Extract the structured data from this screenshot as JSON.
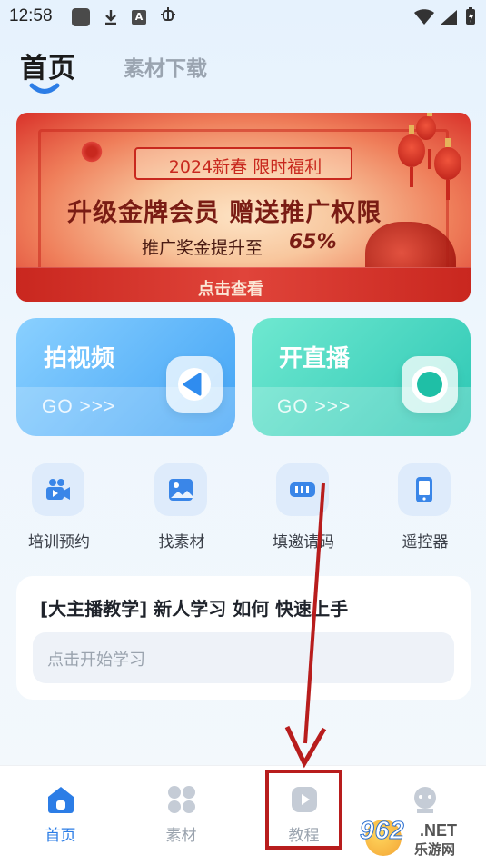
{
  "status_bar": {
    "time": "12:58",
    "icons": [
      "app-square-icon",
      "download-icon",
      "a-badge-icon",
      "bug-icon",
      "wifi-icon",
      "signal-icon",
      "battery-icon"
    ]
  },
  "top_tabs": {
    "home": "首页",
    "materials_download": "素材下载"
  },
  "banner": {
    "tag": "2024新春 限时福利",
    "headline": "升级金牌会员 赠送推广权限",
    "subline": "推广奖金提升至",
    "percent": "65%",
    "cta": "点击查看"
  },
  "cards": {
    "video": {
      "title": "拍视频",
      "go": "GO >>>",
      "accent": "#41a3f5"
    },
    "live": {
      "title": "开直播",
      "go": "GO >>>",
      "accent": "#2cc7b4"
    }
  },
  "quick_actions": [
    {
      "label": "培训预约",
      "icon": "video-camera-icon"
    },
    {
      "label": "找素材",
      "icon": "image-icon"
    },
    {
      "label": "填邀请码",
      "icon": "code-input-icon"
    },
    {
      "label": "遥控器",
      "icon": "phone-remote-icon"
    }
  ],
  "course": {
    "title": "[大主播教学] 新人学习 如何 快速上手",
    "placeholder": "点击开始学习"
  },
  "bottom_nav": [
    {
      "label": "首页",
      "icon": "home-icon",
      "active": true
    },
    {
      "label": "素材",
      "icon": "grid-icon",
      "active": false
    },
    {
      "label": "教程",
      "icon": "play-tutorial-icon",
      "active": false
    },
    {
      "label": "",
      "icon": "profile-icon",
      "active": false
    }
  ],
  "watermark": {
    "brand": "962",
    "suffix": ".NET",
    "site": "乐游网"
  },
  "colors": {
    "primary": "#2c7de6",
    "annotation": "#b81d1d"
  }
}
